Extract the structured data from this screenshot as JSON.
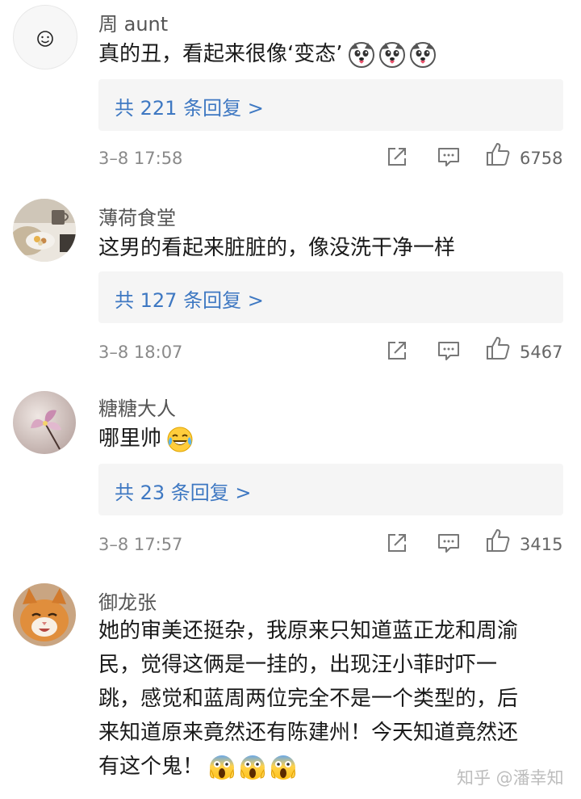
{
  "comments": [
    {
      "username": "周 aunt",
      "text": "真的丑，看起来很像‘变态’",
      "emojis": [
        "husky-emoji",
        "husky-emoji",
        "husky-emoji"
      ],
      "replies": "共 221 条回复 >",
      "time": "3–8 17:58",
      "likes": "6758"
    },
    {
      "username": "薄荷食堂",
      "text": "这男的看起来脏脏的，像没洗干净一样",
      "emojis": [],
      "replies": "共 127 条回复 >",
      "time": "3–8 18:07",
      "likes": "5467"
    },
    {
      "username": "糖糖大人",
      "text": "哪里帅",
      "emojis": [
        "laugh-cry-emoji"
      ],
      "replies": "共 23 条回复 >",
      "time": "3–8 17:57",
      "likes": "3415"
    },
    {
      "username": "御龙张",
      "text_lines": [
        "她的审美还挺杂，我原来只知道蓝正龙和周渝",
        "民，觉得这俩是一挂的，出现汪小菲时吓一",
        "跳，感觉和蓝周两位完全不是一个类型的，后",
        "来知道原来竟然还有陈建州！今天知道竟然还",
        "有这个鬼！"
      ],
      "emojis": [
        "scream-emoji",
        "scream-emoji",
        "scream-emoji"
      ]
    }
  ],
  "watermark": "知乎 @潘幸知",
  "icons": {
    "share": "share-icon",
    "comment": "comment-icon",
    "like": "thumbs-up-icon"
  },
  "colors": {
    "reply_link": "#3e78c2",
    "reply_bg": "#f5f5f5",
    "meta_gray": "#8a8a8a"
  }
}
